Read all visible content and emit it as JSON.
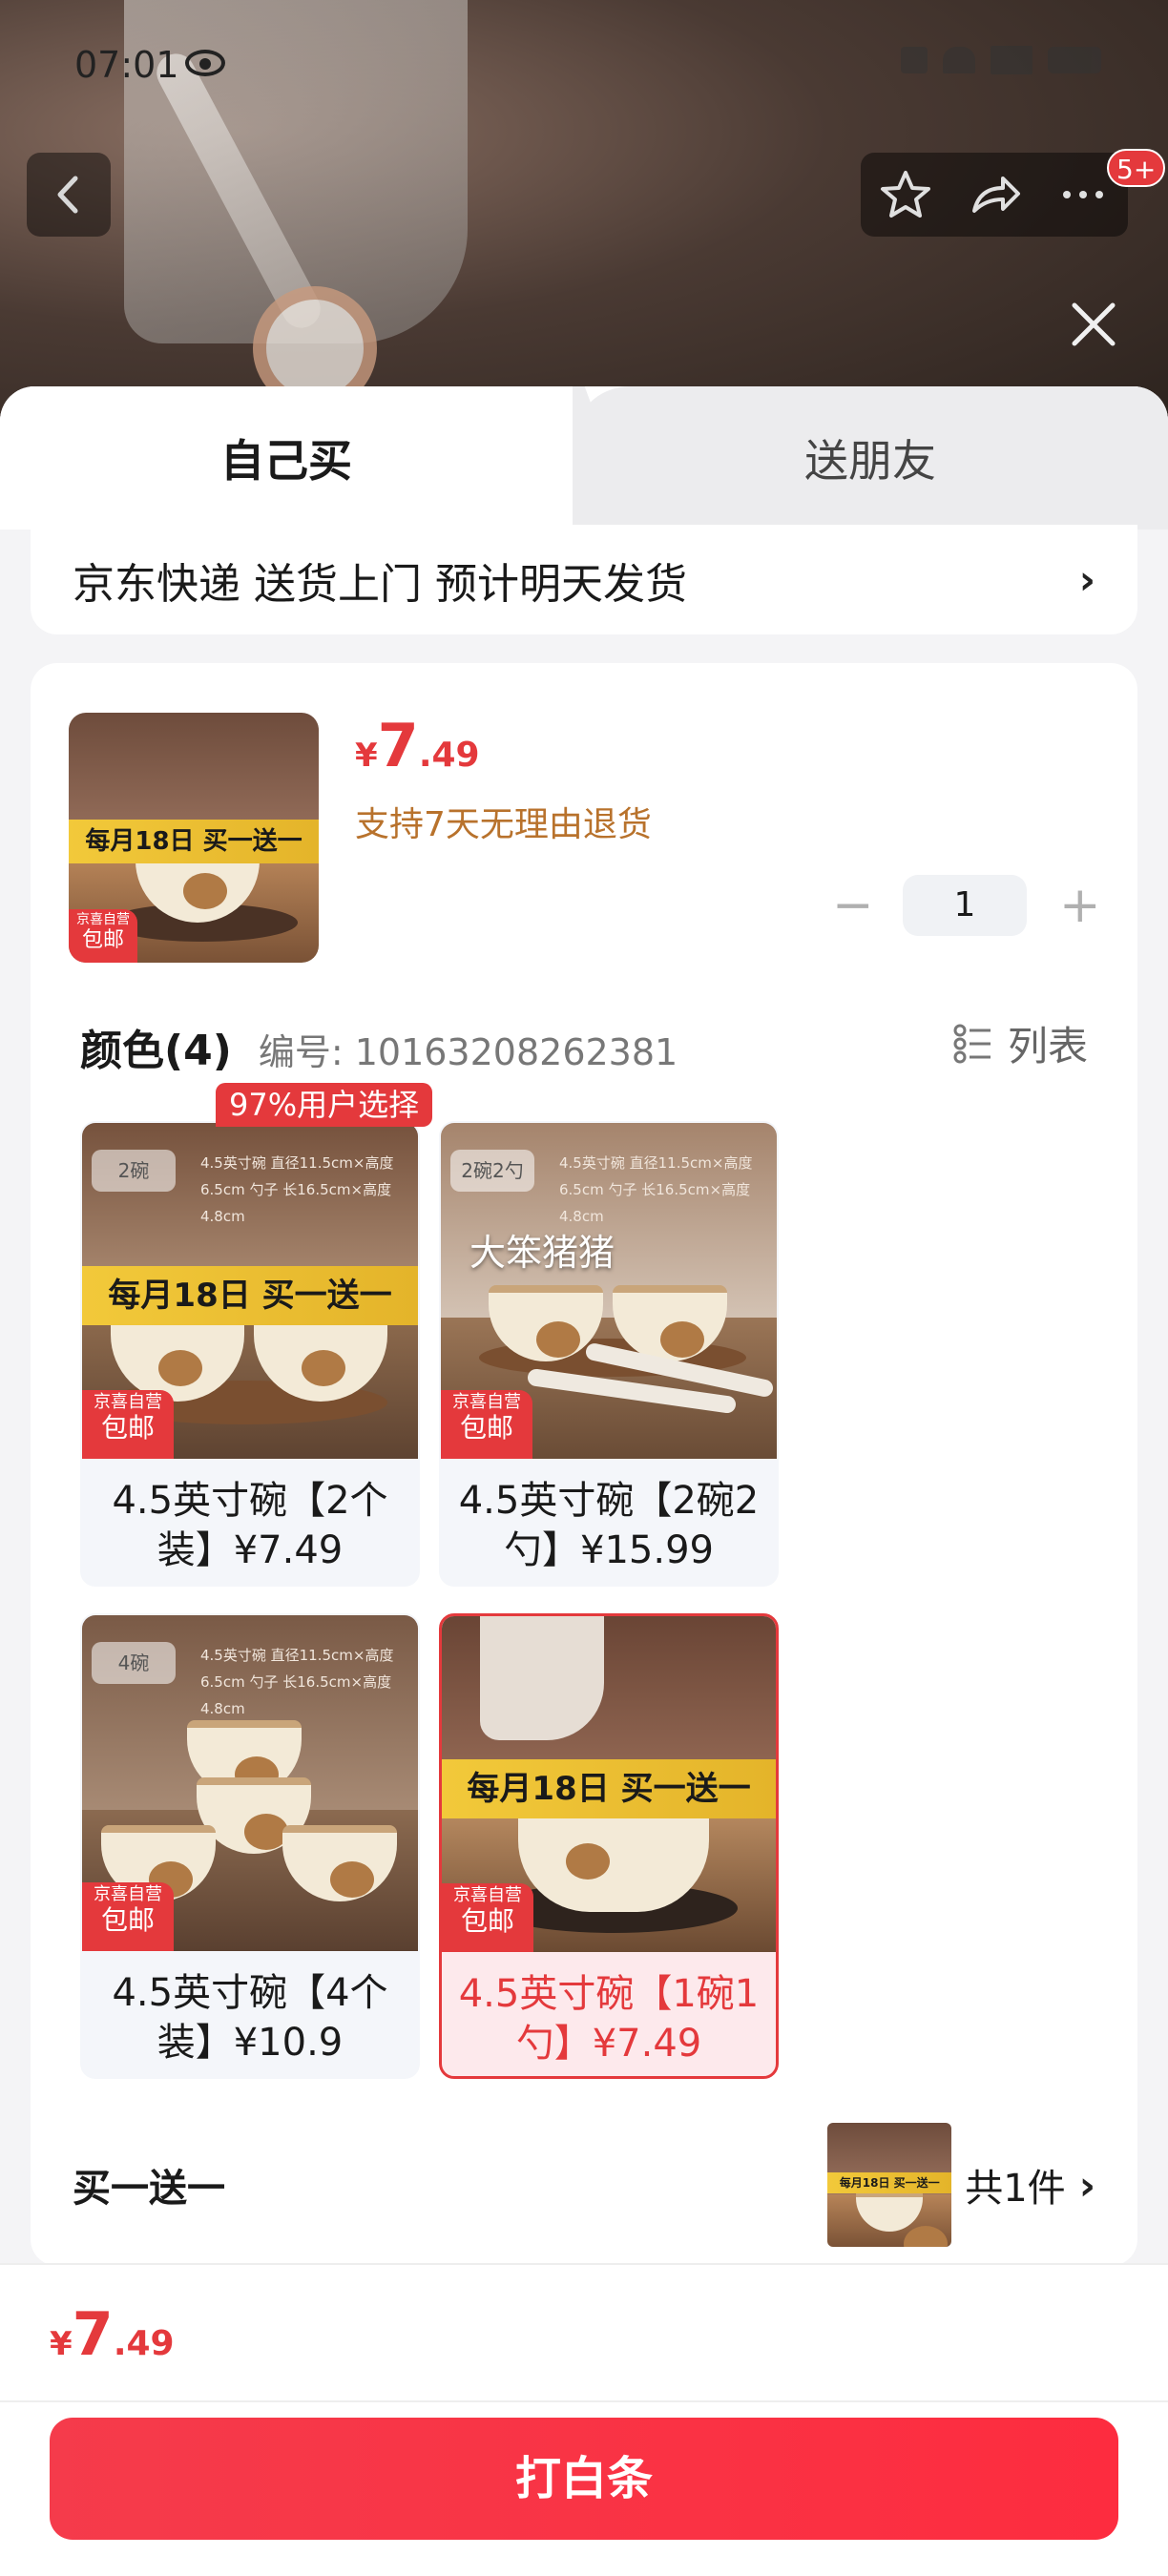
{
  "status": {
    "time": "07:01"
  },
  "header": {
    "badge": "5+"
  },
  "tabs": [
    {
      "label": "自己买"
    },
    {
      "label": "送朋友"
    }
  ],
  "delivery": {
    "text": "京东快递 送货上门 预计明天发货",
    "chevron": "›"
  },
  "product": {
    "price": {
      "currency": "¥",
      "integer": "7",
      "decimal": ".49"
    },
    "return_note": "支持7天无理由退货",
    "quantity": "1",
    "thumb_promo": "每月18日 买一送一",
    "mail_badge_top": "京喜自营",
    "mail_badge": "包邮"
  },
  "variant_section": {
    "title": "颜色(4)",
    "sku_code": "编号: 10163208262381",
    "list_toggle": "列表",
    "popular_tag": "97%用户选择",
    "options": [
      {
        "label": "4.5英寸碗【2个装】¥7.49",
        "count_tag": "2碗",
        "spec": "4.5英寸碗 直径11.5cm×高度6.5cm 勺子 长16.5cm×高度4.8cm",
        "promo": "每月18日 买一送一",
        "selected": false
      },
      {
        "label": "4.5英寸碗【2碗2勺】¥15.99",
        "count_tag": "2碗2勺",
        "spec": "4.5英寸碗 直径11.5cm×高度6.5cm 勺子 长16.5cm×高度4.8cm",
        "overlay": "大笨猪猪",
        "selected": false
      },
      {
        "label": "4.5英寸碗【4个装】¥10.9",
        "count_tag": "4碗",
        "spec": "4.5英寸碗 直径11.5cm×高度6.5cm 勺子 长16.5cm×高度4.8cm",
        "selected": false
      },
      {
        "label": "4.5英寸碗【1碗1勺】¥7.49",
        "promo": "每月18日 买一送一",
        "selected": true
      }
    ]
  },
  "bogo": {
    "title": "买一送一",
    "count": "共1件",
    "chevron": "›"
  },
  "footer": {
    "price": {
      "currency": "¥",
      "integer": "7",
      "decimal": ".49"
    },
    "buy_button": "打白条"
  },
  "colors": {
    "accent": "#e4393c",
    "return_note": "#b8722c",
    "promo_band": "#f2c93a"
  }
}
